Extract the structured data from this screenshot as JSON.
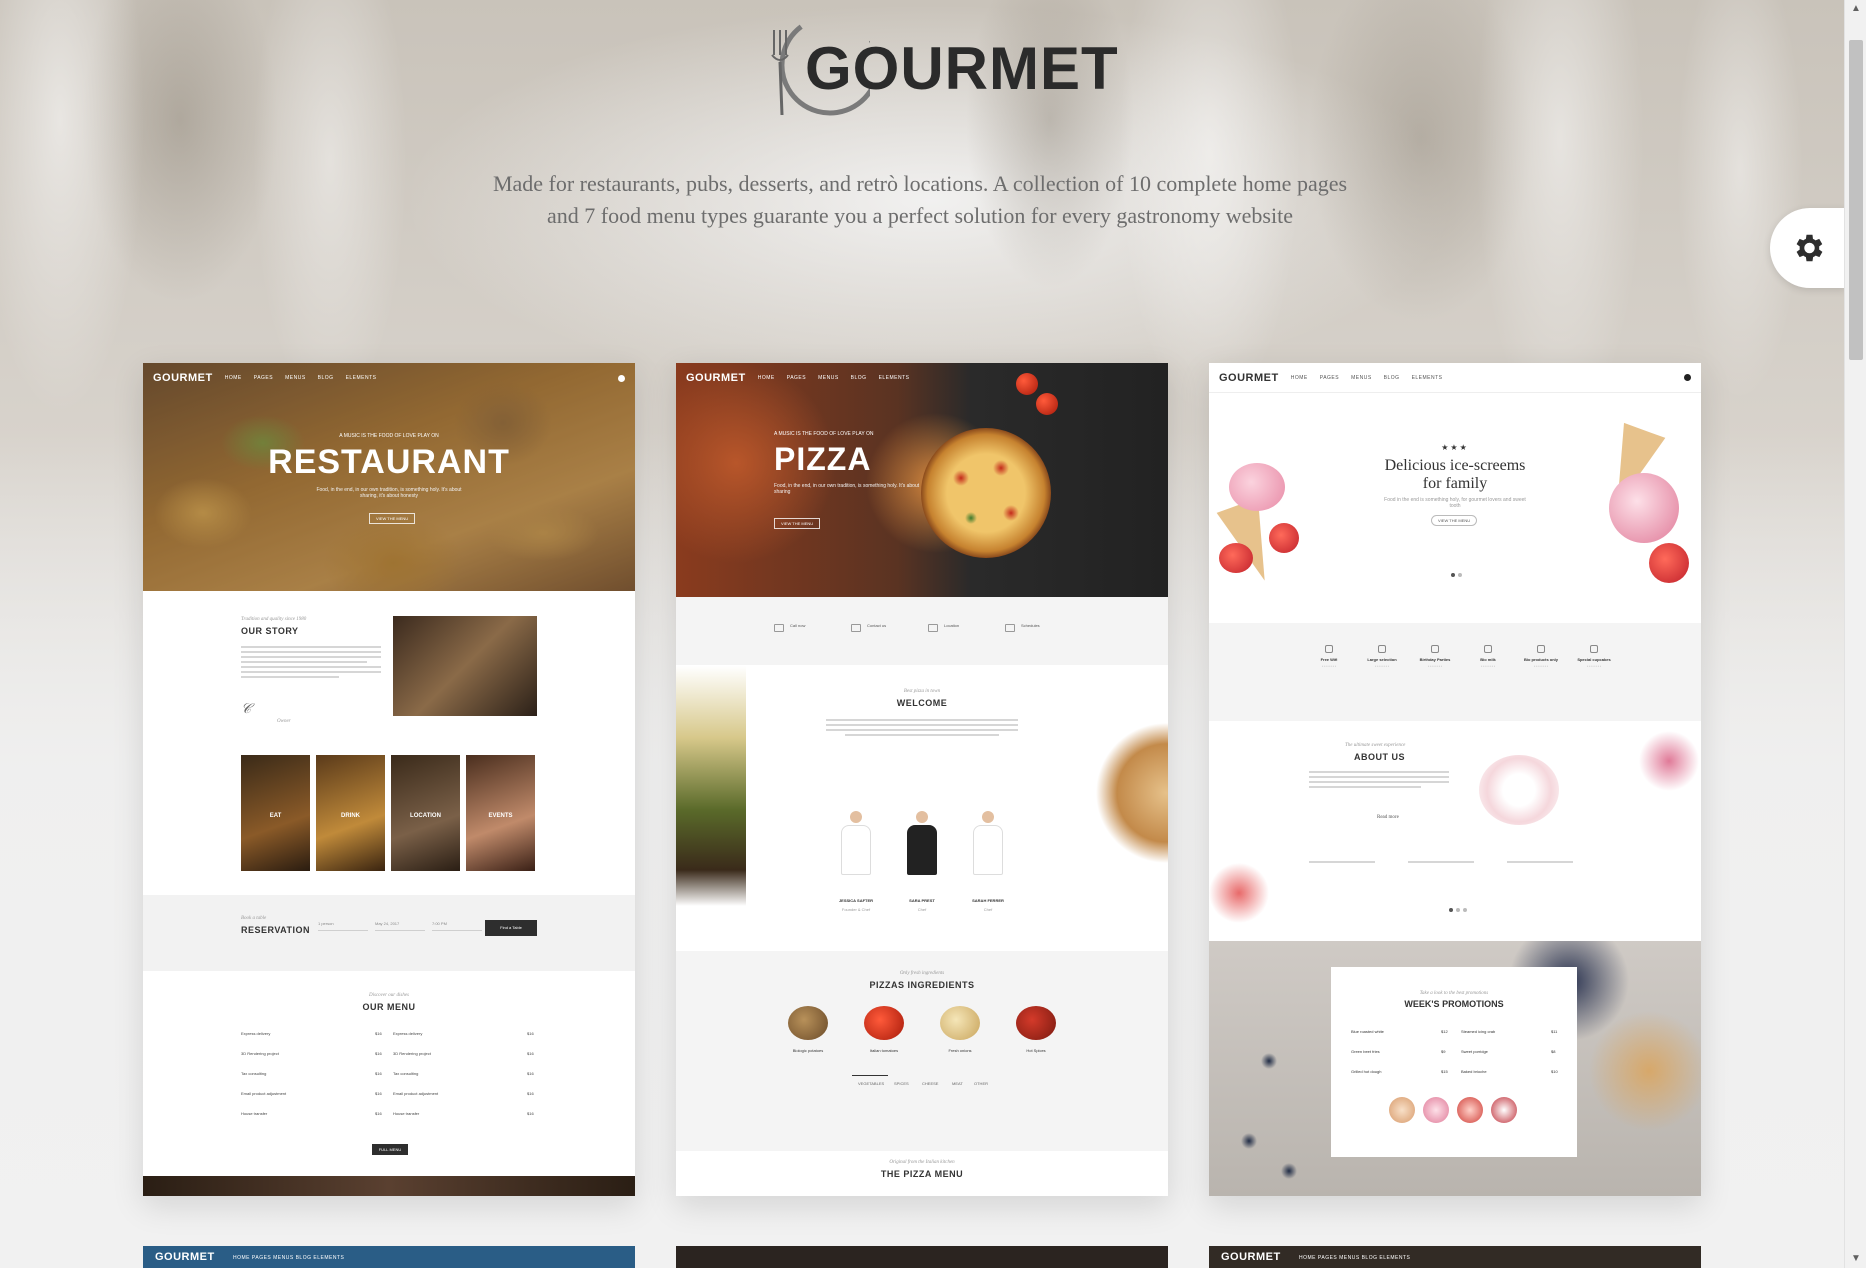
{
  "brand": {
    "name": "GOURMET",
    "tagline_line1": "Made for restaurants, pubs, desserts, and retrò locations. A collection of 10 complete home pages",
    "tagline_line2": "and 7 food menu types guarante you a perfect solution for every gastronomy website"
  },
  "settings": {
    "icon": "gear-icon"
  },
  "previews": [
    {
      "logo": "GOURMET",
      "nav": [
        "HOME",
        "PAGES",
        "MENUS",
        "BLOG",
        "ELEMENTS"
      ],
      "hero_kicker": "A MUSIC IS THE FOOD OF LOVE PLAY ON",
      "hero_title": "RESTAURANT",
      "hero_text": "Food, in the end, in our own tradition, is something holy. It's about sharing, it's about honesty",
      "hero_button": "VIEW THE MENU",
      "story_kicker": "Tradition and quality since 1980",
      "story_title": "OUR STORY",
      "story_signature": "Owner",
      "tiles": [
        "EAT",
        "DRINK",
        "LOCATION",
        "EVENTS"
      ],
      "reservation_kicker": "Book a table",
      "reservation_title": "RESERVATION",
      "reservation_fields": [
        "1 person",
        "May 24, 2017",
        "7:00 PM"
      ],
      "reservation_button": "Find a Table",
      "menu_kicker": "Discover our dishes",
      "menu_title": "OUR MENU",
      "menu_items": [
        "Express delivery",
        "3D Rendering project",
        "Tax consulting",
        "Email product adjustment",
        "House transfer"
      ],
      "menu_prices": [
        "$16",
        "$16",
        "$16",
        "$16",
        "$16"
      ],
      "menu_button": "FULL MENU"
    },
    {
      "logo": "GOURMET",
      "nav": [
        "HOME",
        "PAGES",
        "MENUS",
        "BLOG",
        "ELEMENTS"
      ],
      "hero_kicker": "A MUSIC IS THE FOOD OF LOVE PLAY ON",
      "hero_title": "PIZZA",
      "hero_text": "Food, in the end, in our own tradition, is something holy. It's about sharing",
      "hero_button": "VIEW THE MENU",
      "contacts": [
        "Call now",
        "Contact us",
        "Location",
        "Schedules"
      ],
      "welcome_kicker": "Best pizza in town",
      "welcome_title": "WELCOME",
      "chefs": [
        {
          "name": "JESSICA SAFTER",
          "role": "Founder & Chef"
        },
        {
          "name": "SARA PREST",
          "role": "Chef"
        },
        {
          "name": "SARAH FERRER",
          "role": "Chef"
        }
      ],
      "ingredients_kicker": "Only fresh ingredients",
      "ingredients_title": "PIZZAS INGREDIENTS",
      "ingredients": [
        "Biologic potatoes",
        "Italian tomatoes",
        "Fresh onions",
        "Hot Spices"
      ],
      "tabs": [
        "VEGETABLES",
        "SPICES",
        "CHEESE",
        "MEAT",
        "OTHER"
      ],
      "menu_kicker": "Original from the Italian kitchen",
      "menu_title": "THE PIZZA MENU"
    },
    {
      "logo": "GOURMET",
      "nav": [
        "HOME",
        "PAGES",
        "MENUS",
        "BLOG",
        "ELEMENTS"
      ],
      "stars": "★★★",
      "hero_title_line1": "Delicious ice-screems",
      "hero_title_line2": "for family",
      "hero_text": "Food in the end is something holy, for gourmet lovers and sweet tooth",
      "hero_button": "VIEW THE MENU",
      "features": [
        "Free Wifi",
        "Large selection",
        "Birthday Parties",
        "Bio milk",
        "Bio products only",
        "Special cupcakes"
      ],
      "about_kicker": "The ultimate sweet experience",
      "about_title": "ABOUT US",
      "about_link": "Read more",
      "promo_kicker": "Take a look to the best promotions",
      "promo_title": "WEEK'S PROMOTIONS",
      "promo_items": [
        "Blue roasted white",
        "Green beet fries",
        "Grilled hot dough",
        "Steamed icing crab",
        "Sweet porridge",
        "Baked brioche"
      ],
      "promo_prices": [
        "$12",
        "$9",
        "$15",
        "$11",
        "$8",
        "$10"
      ]
    }
  ],
  "second_row": [
    {
      "logo": "GOURMET",
      "nav": "HOME   PAGES   MENUS   BLOG   ELEMENTS"
    },
    {
      "logo": "",
      "nav": ""
    },
    {
      "logo": "GOURMET",
      "nav": "HOME   PAGES   MENUS   BLOG   ELEMENTS"
    }
  ],
  "colors": {
    "accent_dark": "#2e2e2e",
    "restaurant_hero": "#b9853f",
    "pizza_dark": "#222222",
    "row2_blue": "#2a5d86"
  }
}
